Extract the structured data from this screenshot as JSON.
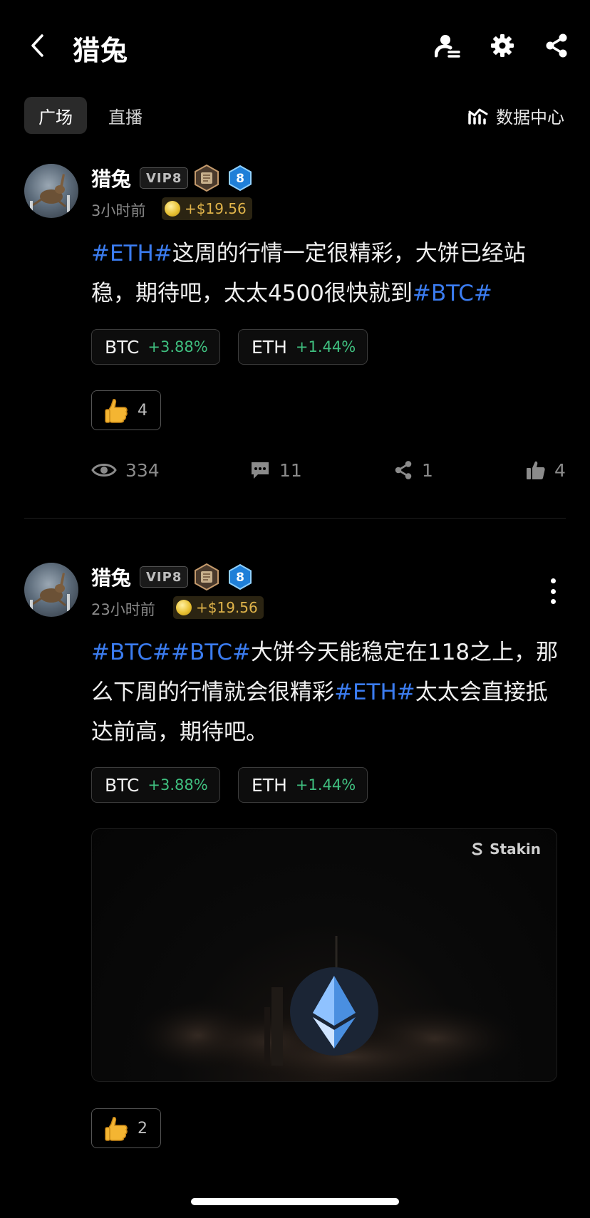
{
  "header": {
    "title": "猎兔",
    "icons": [
      "back-icon",
      "user-follow-icon",
      "settings-icon",
      "share-icon"
    ]
  },
  "tabs": [
    {
      "label": "广场",
      "active": true
    },
    {
      "label": "直播",
      "active": false
    }
  ],
  "data_center": {
    "label": "数据中心",
    "icon": "chart-icon"
  },
  "posts": [
    {
      "username": "猎兔",
      "vip": "VIP8",
      "level": "8",
      "time": "3小时前",
      "tip": "+$19.56",
      "content": [
        {
          "text": "#ETH#",
          "tag": true
        },
        {
          "text": "这周的行情一定很精彩，大饼已经站稳，期待吧，太太4500很快就到",
          "tag": false
        },
        {
          "text": "#BTC#",
          "tag": true
        }
      ],
      "chips": [
        {
          "symbol": "BTC",
          "change": "+3.88%"
        },
        {
          "symbol": "ETH",
          "change": "+1.44%"
        }
      ],
      "reaction_count": "4",
      "stats": {
        "views": "334",
        "comments": "11",
        "shares": "1",
        "likes": "4"
      }
    },
    {
      "username": "猎兔",
      "vip": "VIP8",
      "level": "8",
      "time": "23小时前",
      "tip": "+$19.56",
      "content": [
        {
          "text": "#BTC#",
          "tag": true
        },
        {
          "text": "#BTC#",
          "tag": true
        },
        {
          "text": "大饼今天能稳定在118之上，那么下周的行情就会很精彩",
          "tag": false
        },
        {
          "text": "#ETH#",
          "tag": true
        },
        {
          "text": "太太会直接抵达前高，期待吧。",
          "tag": false
        }
      ],
      "chips": [
        {
          "symbol": "BTC",
          "change": "+3.88%"
        },
        {
          "symbol": "ETH",
          "change": "+1.44%"
        }
      ],
      "media": {
        "brand": "Stakin",
        "icon": "ethereum-logo-icon"
      },
      "reaction_count": "2"
    }
  ],
  "colors": {
    "background": "#000000",
    "hashtag": "#3b7cf0",
    "positive": "#3fbf7f",
    "tip": "#e0b44a"
  }
}
